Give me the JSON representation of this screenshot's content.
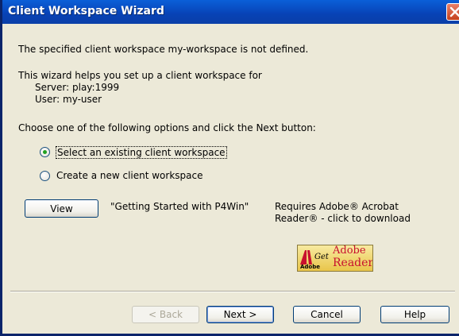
{
  "window": {
    "title": "Client Workspace Wizard"
  },
  "message": {
    "not_defined": "The specified client workspace my-workspace is not defined.",
    "intro": "This wizard helps you set up a client workspace for",
    "server": "Server: play:1999",
    "user": "User: my-user",
    "instruction": "Choose one of the following options and click the Next button:"
  },
  "options": {
    "selected": "existing",
    "existing_label": "Select an existing client workspace",
    "new_label": "Create a new client workspace"
  },
  "getting_started": {
    "view_button": "View",
    "description": "\"Getting Started with P4Win\"",
    "requires_line1": "Requires Adobe® Acrobat",
    "requires_line2": "Reader® - click to download"
  },
  "adobe_badge": {
    "get": "Get",
    "brand": "Adobe",
    "product": "Reader",
    "small": "Adobe"
  },
  "buttons": {
    "back": "< Back",
    "next": "Next >",
    "cancel": "Cancel",
    "help": "Help"
  },
  "colors": {
    "title_bar": "#0842b5",
    "dialog_bg": "#ece9d8",
    "radio_selected": "#21a121",
    "adobe_red": "#c8102e"
  }
}
